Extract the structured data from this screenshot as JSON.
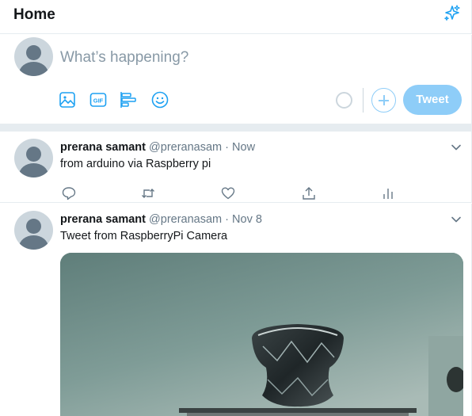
{
  "header": {
    "title": "Home",
    "icon": "sparkle-icon"
  },
  "composer": {
    "placeholder": "What’s happening?",
    "tools": [
      "image-icon",
      "gif-icon",
      "poll-icon",
      "emoji-icon"
    ],
    "gif_label": "GIF",
    "tweet_button": "Tweet"
  },
  "tweets": [
    {
      "name": "prerana samant",
      "handle": "@preranasam",
      "separator": "·",
      "time": "Now",
      "text": "from arduino via Raspberry pi",
      "actions": [
        "reply-icon",
        "retweet-icon",
        "like-icon",
        "share-icon",
        "analytics-icon"
      ]
    },
    {
      "name": "prerana samant",
      "handle": "@preranasam",
      "separator": "·",
      "time": "Nov 8",
      "text": "Tweet from RaspberryPi Camera",
      "media": "photo of a glass object on a stand against a teal wall"
    }
  ],
  "colors": {
    "accent": "#1da1f2",
    "accent_light": "#8ecdf8",
    "border": "#e6ecf0",
    "text_secondary": "#657786"
  }
}
